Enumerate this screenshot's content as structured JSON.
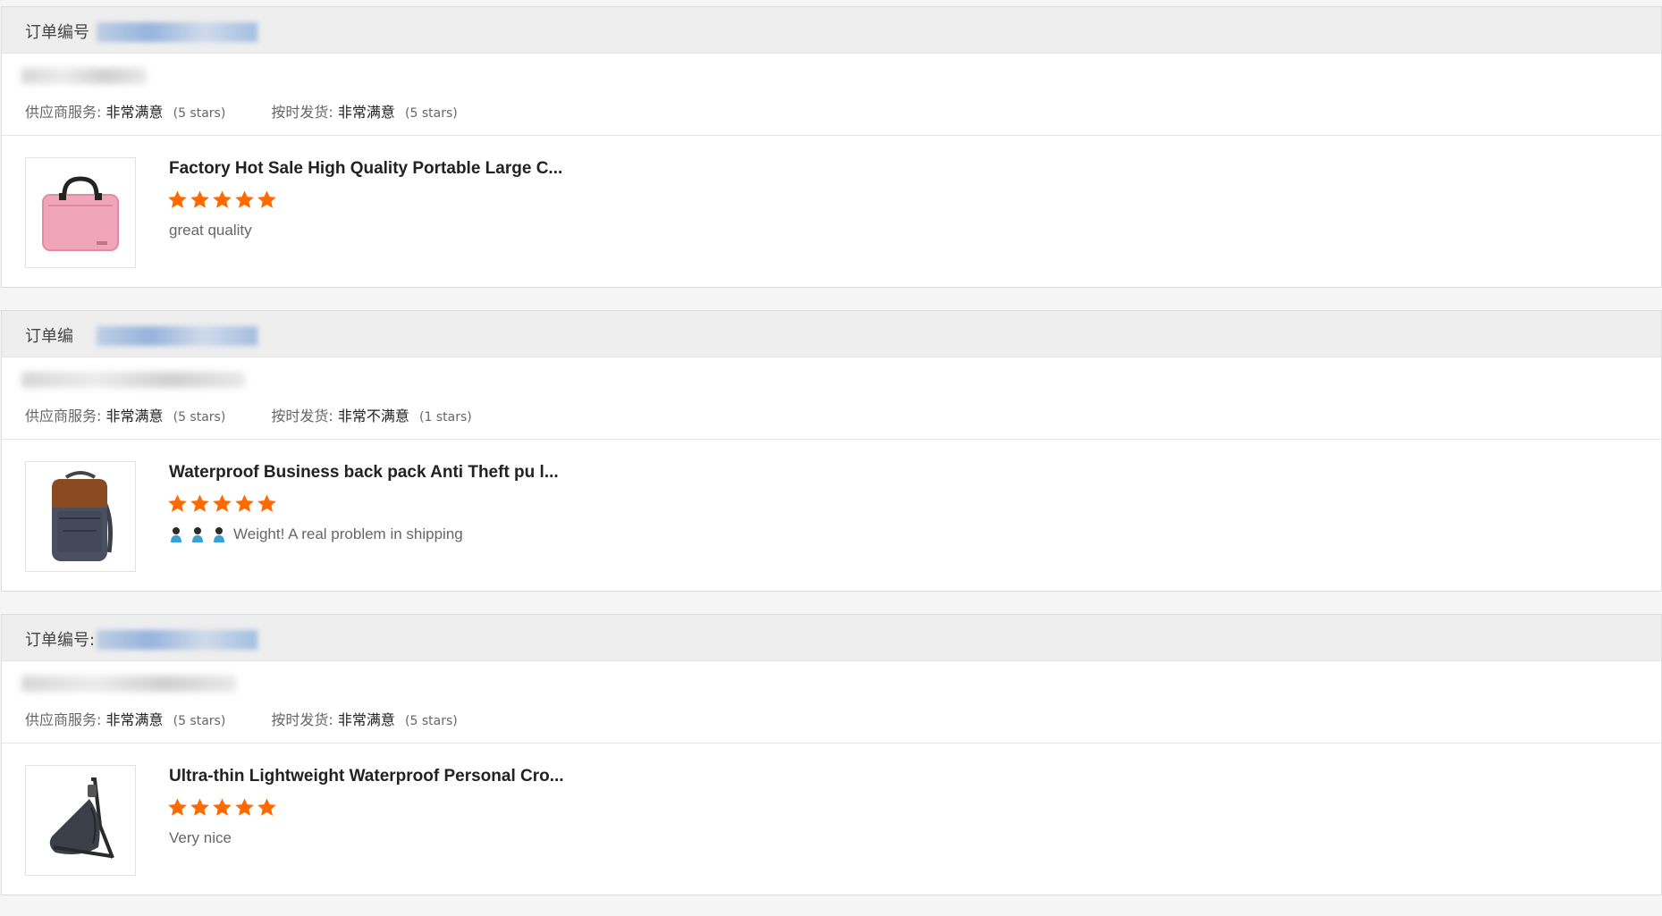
{
  "accent_star_color": "#ff6a00",
  "orders": [
    {
      "order_label": "订单编号",
      "supplier_service_label": "供应商服务:",
      "supplier_service_value": "非常满意",
      "supplier_service_stars": "(5 stars)",
      "on_time_label": "按时发货:",
      "on_time_value": "非常满意",
      "on_time_stars": "(5 stars)",
      "product_title": "Factory Hot Sale High Quality Portable Large C...",
      "rating": 5,
      "comment": "great quality",
      "thumbnail_icon": "pink-laptop-bag-icon"
    },
    {
      "order_label": "订单编",
      "supplier_service_label": "供应商服务:",
      "supplier_service_value": "非常满意",
      "supplier_service_stars": "(5 stars)",
      "on_time_label": "按时发货:",
      "on_time_value": "非常不满意",
      "on_time_stars": "(1 stars)",
      "product_title": "Waterproof Business back pack Anti Theft pu l...",
      "rating": 5,
      "comment": "Weight! A real problem in shipping",
      "comment_emoji": "person-emoji-icon",
      "thumbnail_icon": "business-backpack-icon"
    },
    {
      "order_label": "订单编号:",
      "supplier_service_label": "供应商服务:",
      "supplier_service_value": "非常满意",
      "supplier_service_stars": "(5 stars)",
      "on_time_label": "按时发货:",
      "on_time_value": "非常满意",
      "on_time_stars": "(5 stars)",
      "product_title": "Ultra-thin Lightweight Waterproof Personal Cro...",
      "rating": 5,
      "comment": "Very nice",
      "thumbnail_icon": "crossbody-sling-bag-icon"
    }
  ]
}
